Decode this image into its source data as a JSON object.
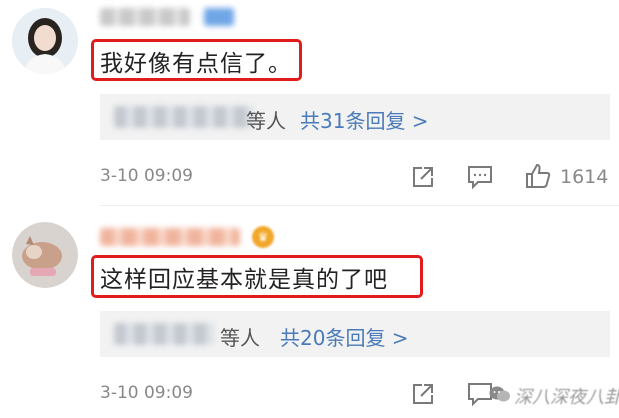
{
  "comments": [
    {
      "text": "我好像有点信了。",
      "reply_suffix": "等人",
      "reply_link": "共31条回复 >",
      "timestamp": "3-10 09:09",
      "likes": "1614"
    },
    {
      "text": "这样回应基本就是真的了吧",
      "reply_suffix": "等人",
      "reply_link": "共20条回复 >",
      "timestamp": "3-10 09:09",
      "likes": ""
    }
  ],
  "watermark": "深八深夜八卦",
  "colors": {
    "highlight_border": "#e01c1c",
    "link": "#4a7bb8",
    "reply_panel_bg": "#f2f2f2"
  },
  "icons": [
    "share-icon",
    "comment-icon",
    "like-icon",
    "vip-badge-icon",
    "wechat-icon"
  ]
}
